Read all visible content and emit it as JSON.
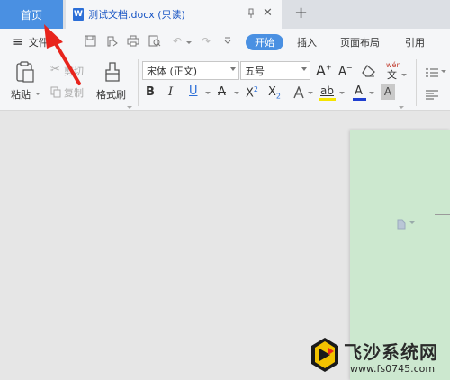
{
  "tabs": {
    "home": "首页",
    "document": {
      "icon_letter": "W",
      "title": "测试文档.docx (只读)"
    },
    "new_tab": "+"
  },
  "menu": {
    "file": "文件",
    "items": [
      "开始",
      "插入",
      "页面布局",
      "引用"
    ]
  },
  "ribbon": {
    "paste": "粘贴",
    "cut": "剪切",
    "copy": "复制",
    "format_painter": "格式刷",
    "font_name": "宋体 (正文)",
    "font_size": "五号",
    "grow_font": "A",
    "shrink_font": "A",
    "phonetic": "wén"
  },
  "watermark": {
    "name": "飞沙系统网",
    "url": "www.fs0745.com"
  },
  "colors": {
    "accent": "#4a90e2",
    "page_bg": "#cce8cf",
    "annotation_arrow": "#e8241c"
  }
}
